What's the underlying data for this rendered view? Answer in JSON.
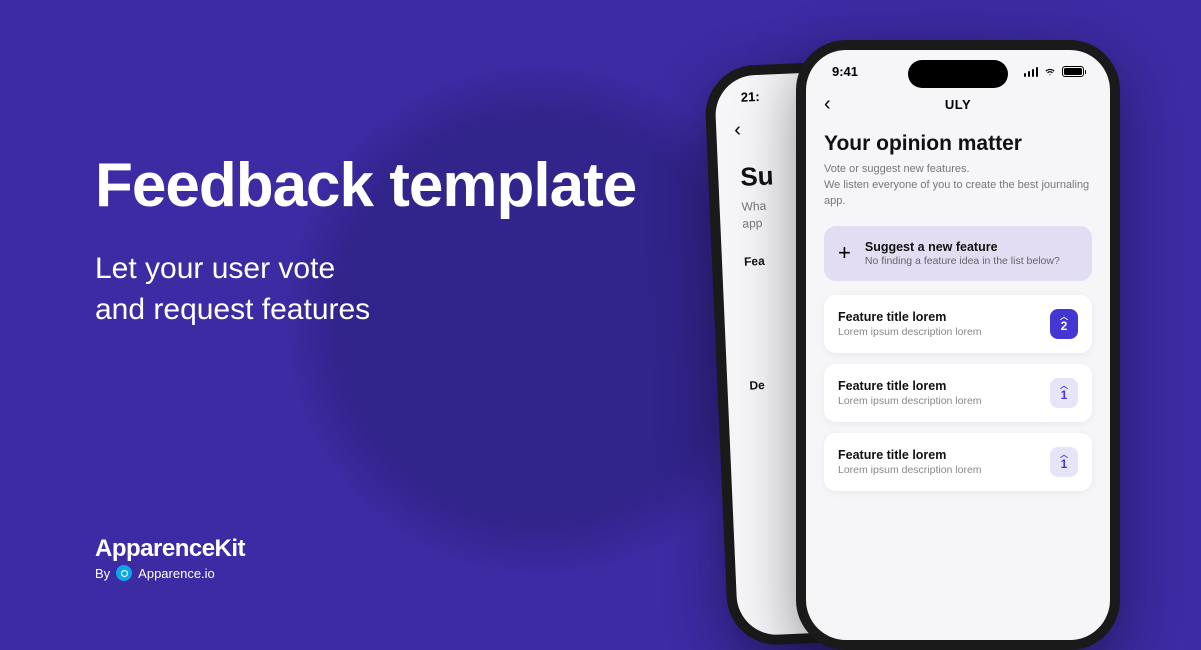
{
  "left": {
    "headline": "Feedback template",
    "sub1": "Let your user vote",
    "sub2": "and request features"
  },
  "brand": {
    "title": "ApparenceKit",
    "by": "By",
    "company": "Apparence.io"
  },
  "phone_back": {
    "time": "21:",
    "heading": "Su",
    "sub": "Wha\napp",
    "label1": "Fea",
    "label2": "De"
  },
  "phone_front": {
    "time": "9:41",
    "nav_title": "ULY",
    "heading": "Your opinion matter",
    "sub": "Vote or suggest new features.\nWe listen everyone of you to create the best journaling app.",
    "suggest": {
      "title": "Suggest a new feature",
      "sub": "No finding a feature idea in the list below?"
    },
    "features": [
      {
        "title": "Feature title lorem",
        "sub": "Lorem ipsum description lorem",
        "votes": "2",
        "primary": true
      },
      {
        "title": "Feature title lorem",
        "sub": "Lorem ipsum description lorem",
        "votes": "1",
        "primary": false
      },
      {
        "title": "Feature title lorem",
        "sub": "Lorem ipsum description lorem",
        "votes": "1",
        "primary": false
      }
    ]
  }
}
